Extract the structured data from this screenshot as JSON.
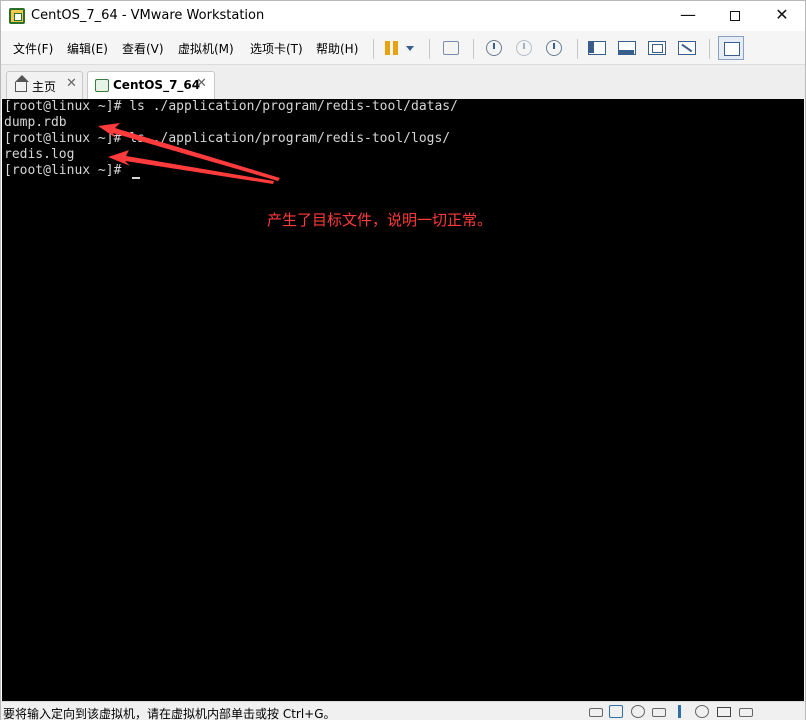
{
  "window": {
    "title": "CentOS_7_64 - VMware Workstation",
    "min_glyph": "—",
    "close_glyph": "✕"
  },
  "menu": {
    "items": [
      "文件(F)",
      "编辑(E)",
      "查看(V)",
      "虚拟机(M)",
      "选项卡(T)",
      "帮助(H)"
    ]
  },
  "toolbar": {
    "icons": [
      "pause-icon",
      "pause-dropdown-icon",
      "send-ctrl-alt-del-icon",
      "snapshot-icon",
      "revert-snapshot-icon",
      "snapshot-manager-icon",
      "show-library-icon",
      "show-thumbnail-bar-icon",
      "full-screen-icon",
      "unity-icon",
      "console-view-icon"
    ]
  },
  "tabs": [
    {
      "label": "主页",
      "icon": "home-icon",
      "close": "✕"
    },
    {
      "label": "CentOS_7_64",
      "icon": "vm-icon",
      "close": "✕",
      "active": true
    }
  ],
  "console": {
    "lines": [
      "[root@linux ~]# ls ./application/program/redis-tool/datas/",
      "dump.rdb",
      "[root@linux ~]# ls ./application/program/redis-tool/logs/",
      "redis.log",
      "[root@linux ~]# "
    ],
    "annotation": "产生了目标文件，说明一切正常。",
    "annotation_color": "#ff3b3b",
    "background": "#000000",
    "foreground": "#d6d6d6"
  },
  "statusbar": {
    "text": "要将输入定向到该虚拟机，请在虚拟机内部单击或按 Ctrl+G。",
    "icons": [
      "hard-disk-icon",
      "network-icon",
      "cd-icon",
      "usb-icon",
      "sound-icon",
      "printer-icon",
      "display-icon",
      "message-icon"
    ]
  }
}
